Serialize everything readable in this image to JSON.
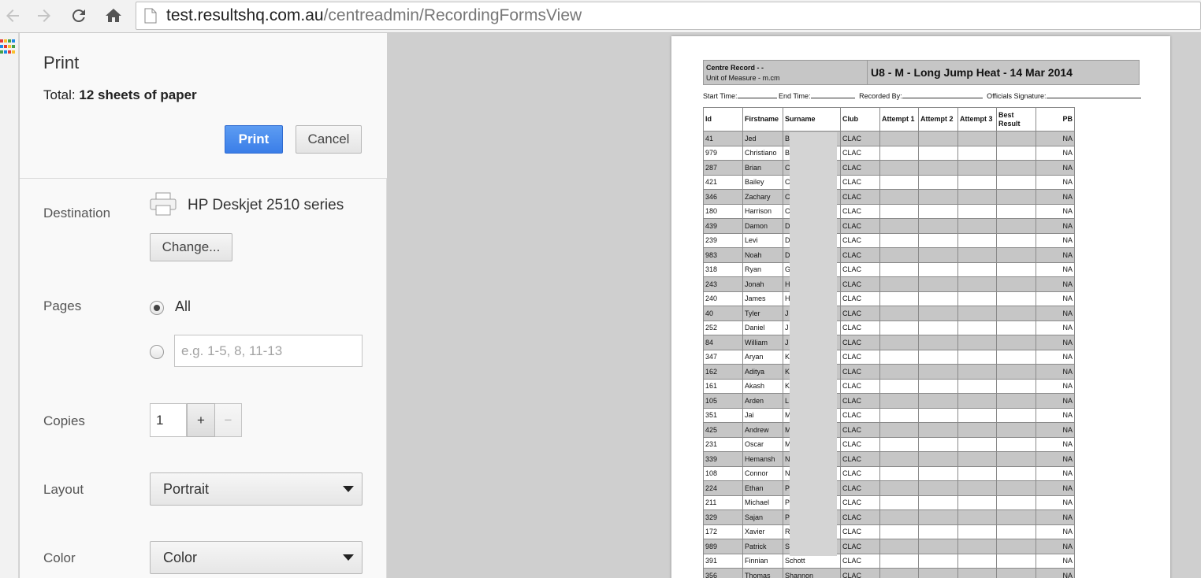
{
  "browser": {
    "url_host": "test.resultshq.com.au",
    "url_path": "/centreadmin/RecordingFormsView"
  },
  "print": {
    "title": "Print",
    "total_label": "Total:",
    "total_value": "12 sheets of paper",
    "print_button": "Print",
    "cancel_button": "Cancel",
    "destination_label": "Destination",
    "destination_name": "HP Deskjet 2510 series",
    "change_button": "Change...",
    "pages_label": "Pages",
    "pages_all": "All",
    "pages_placeholder": "e.g. 1-5, 8, 11-13",
    "copies_label": "Copies",
    "copies_value": "1",
    "copies_plus": "+",
    "copies_minus": "−",
    "layout_label": "Layout",
    "layout_value": "Portrait",
    "color_label": "Color",
    "color_value": "Color"
  },
  "form": {
    "centre_record": "Centre Record - -",
    "unit_of_measure": "Unit of Measure - m.cm",
    "event_title": "U8 - M - Long Jump Heat - 14 Mar 2014",
    "start_time": "Start Time:",
    "end_time": "End Time:",
    "recorded_by": "Recorded By:",
    "officials_signature": "Officials Signature:",
    "columns": [
      "Id",
      "Firstname",
      "Surname",
      "Club",
      "Attempt 1",
      "Attempt 2",
      "Attempt 3",
      "Best Result",
      "PB"
    ],
    "rows": [
      {
        "id": "41",
        "first": "Jed",
        "sur": "B",
        "club": "CLAC",
        "pb": "NA"
      },
      {
        "id": "979",
        "first": "Christiano",
        "sur": "B",
        "club": "CLAC",
        "pb": "NA"
      },
      {
        "id": "287",
        "first": "Brian",
        "sur": "C",
        "club": "CLAC",
        "pb": "NA"
      },
      {
        "id": "421",
        "first": "Bailey",
        "sur": "C",
        "club": "CLAC",
        "pb": "NA"
      },
      {
        "id": "346",
        "first": "Zachary",
        "sur": "C",
        "club": "CLAC",
        "pb": "NA"
      },
      {
        "id": "180",
        "first": "Harrison",
        "sur": "C",
        "club": "CLAC",
        "pb": "NA"
      },
      {
        "id": "439",
        "first": "Damon",
        "sur": "D",
        "club": "CLAC",
        "pb": "NA"
      },
      {
        "id": "239",
        "first": "Levi",
        "sur": "D",
        "club": "CLAC",
        "pb": "NA"
      },
      {
        "id": "983",
        "first": "Noah",
        "sur": "D",
        "club": "CLAC",
        "pb": "NA"
      },
      {
        "id": "318",
        "first": "Ryan",
        "sur": "G",
        "club": "CLAC",
        "pb": "NA"
      },
      {
        "id": "243",
        "first": "Jonah",
        "sur": "H",
        "club": "CLAC",
        "pb": "NA"
      },
      {
        "id": "240",
        "first": "James",
        "sur": "H",
        "club": "CLAC",
        "pb": "NA"
      },
      {
        "id": "40",
        "first": "Tyler",
        "sur": "J",
        "club": "CLAC",
        "pb": "NA"
      },
      {
        "id": "252",
        "first": "Daniel",
        "sur": "J",
        "club": "CLAC",
        "pb": "NA"
      },
      {
        "id": "84",
        "first": "William",
        "sur": "J",
        "club": "CLAC",
        "pb": "NA"
      },
      {
        "id": "347",
        "first": "Aryan",
        "sur": "K",
        "club": "CLAC",
        "pb": "NA"
      },
      {
        "id": "162",
        "first": "Aditya",
        "sur": "K",
        "club": "CLAC",
        "pb": "NA"
      },
      {
        "id": "161",
        "first": "Akash",
        "sur": "K",
        "club": "CLAC",
        "pb": "NA"
      },
      {
        "id": "105",
        "first": "Arden",
        "sur": "L",
        "club": "CLAC",
        "pb": "NA"
      },
      {
        "id": "351",
        "first": "Jai",
        "sur": "M",
        "club": "CLAC",
        "pb": "NA"
      },
      {
        "id": "425",
        "first": "Andrew",
        "sur": "M",
        "club": "CLAC",
        "pb": "NA"
      },
      {
        "id": "231",
        "first": "Oscar",
        "sur": "M",
        "club": "CLAC",
        "pb": "NA"
      },
      {
        "id": "339",
        "first": "Hemansh",
        "sur": "N",
        "club": "CLAC",
        "pb": "NA"
      },
      {
        "id": "108",
        "first": "Connor",
        "sur": "N",
        "club": "CLAC",
        "pb": "NA"
      },
      {
        "id": "224",
        "first": "Ethan",
        "sur": "P",
        "club": "CLAC",
        "pb": "NA"
      },
      {
        "id": "211",
        "first": "Michael",
        "sur": "P",
        "club": "CLAC",
        "pb": "NA"
      },
      {
        "id": "329",
        "first": "Sajan",
        "sur": "P",
        "club": "CLAC",
        "pb": "NA"
      },
      {
        "id": "172",
        "first": "Xavier",
        "sur": "R",
        "club": "CLAC",
        "pb": "NA"
      },
      {
        "id": "989",
        "first": "Patrick",
        "sur": "S",
        "club": "CLAC",
        "pb": "NA"
      },
      {
        "id": "391",
        "first": "Finnian",
        "sur": "Schott",
        "club": "CLAC",
        "pb": "NA"
      },
      {
        "id": "356",
        "first": "Thomas",
        "sur": "Shannon",
        "club": "CLAC",
        "pb": "NA"
      }
    ]
  },
  "icons": {
    "back": "back-arrow-icon",
    "forward": "forward-arrow-icon",
    "reload": "reload-icon",
    "home": "home-icon",
    "page": "document-icon",
    "printer": "printer-icon",
    "apps": "apps-grid-icon"
  },
  "colors": {
    "print_button": "#3b7ee8",
    "row_shade": "#c6c6c6"
  }
}
